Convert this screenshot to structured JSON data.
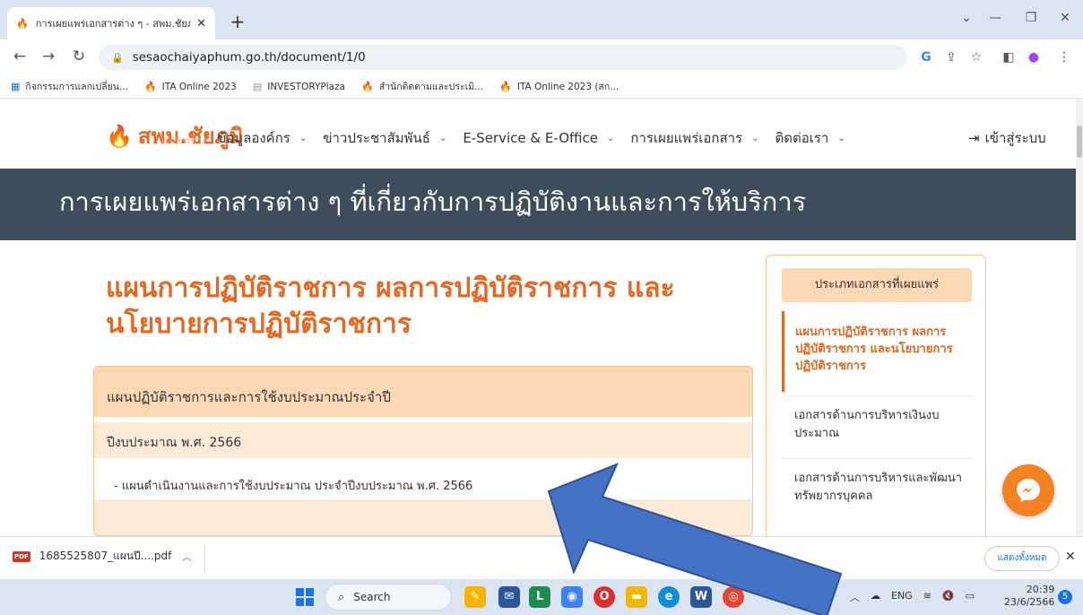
{
  "browser": {
    "tab_title": "การเผยแพร่เอกสารต่าง ๆ - สพม.ชัยภ",
    "url": "sesaochaiyaphum.go.th/document/1/0",
    "bookmarks": [
      "กิจกรรมการแลกเปลี่ยน...",
      "ITA Online 2023",
      "INVESTORYPlaza",
      "สำนักติดตามและประเมิ...",
      "ITA Online 2023 (สก..."
    ]
  },
  "site": {
    "logo_text": "สพม.ชัยภูมิ",
    "logo_sub": "เอกสารต่าง",
    "menu": [
      "ข้อมูลองค์กร",
      "ข่าวประชาสัมพันธ์",
      "E-Service & E-Office",
      "การเผยแพร่เอกสาร",
      "ติดต่อเรา"
    ],
    "login_label": "เข้าสู่ระบบ",
    "banner_title": "การเผยแพร่เอกสารต่าง ๆ ที่เกี่ยวกับการปฏิบัติงานและการให้บริการ"
  },
  "content": {
    "heading": "แผนการปฏิบัติราชการ ผลการปฏิบัติราชการ และนโยบายการปฏิบัติราชการ",
    "panel_header": "แผนปฏิบัติราชการและการใช้งบประมาณประจำปี",
    "year_label": "ปีงบประมาณ พ.ศ. 2566",
    "doc_link": "- แผนดำเนินงานและการใช้งบประมาณ ประจำปีงบประมาณ พ.ศ. 2566"
  },
  "sidebar": {
    "header": "ประเภทเอกสารที่เผยแพร่",
    "active": "แผนการปฏิบัติราชการ ผลการปฏิบัติราชการ และนโยบายการปฏิบัติราชการ",
    "items": [
      "เอกสารด้านการบริหารเงินงบประมาณ",
      "เอกสารด้านการบริหารและพัฒนาทรัพยากรบุคคล"
    ]
  },
  "downloads": {
    "file_name": "1685525807_แผนปี....pdf",
    "show_all": "แสดงทั้งหมด"
  },
  "taskbar": {
    "search_placeholder": "Search",
    "lang": "ENG",
    "time": "20:39",
    "date": "23/6/2566",
    "notification_count": "5"
  },
  "colors": {
    "accent": "#e8661f",
    "banner": "#3d4d5c",
    "panel_header": "#fcd8b4",
    "arrow": "#4472c4"
  }
}
